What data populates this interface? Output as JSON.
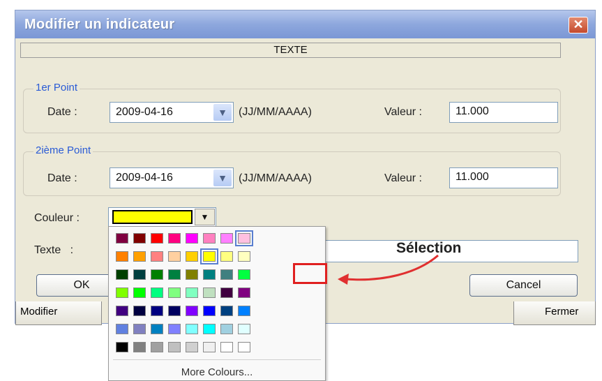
{
  "dialog": {
    "title": "Modifier un indicateur",
    "close_label": "✕",
    "type_header": "TEXTE"
  },
  "point1": {
    "legend": "1er Point",
    "date_label": "Date :",
    "date_value": "2009-04-16",
    "date_format": "(JJ/MM/AAAA)",
    "value_label": "Valeur :",
    "value": "11.000"
  },
  "point2": {
    "legend": "2ième Point",
    "date_label": "Date :",
    "date_value": "2009-04-16",
    "date_format": "(JJ/MM/AAAA)",
    "value_label": "Valeur :",
    "value": "11.000"
  },
  "color": {
    "label": "Couleur :",
    "selected": "#ffff00"
  },
  "text_label": "Texte   :",
  "buttons": {
    "ok": "OK",
    "cancel": "Cancel"
  },
  "background_buttons": {
    "modify": "Modifier",
    "close": "Fermer"
  },
  "palette": {
    "more_colours": "More Colours...",
    "rows": [
      [
        "#7f0040",
        "#800000",
        "#ff0000",
        "#ff0080",
        "#ff00ff",
        "#ff80c0",
        "#ff80ff",
        "#ffc0e0"
      ],
      [
        "#ff8000",
        "#ffa000",
        "#ff8080",
        "#ffd0a0",
        "#ffd000",
        "#ffff00",
        "#ffff80",
        "#ffffc0"
      ],
      [
        "#004000",
        "#004040",
        "#008000",
        "#008040",
        "#808000",
        "#008080",
        "#408080",
        "#00ff40"
      ],
      [
        "#80ff00",
        "#00ff00",
        "#00ff80",
        "#80ff80",
        "#80ffc0",
        "#c0e0c0",
        "#400040",
        "#800080"
      ],
      [
        "#400080",
        "#000040",
        "#000080",
        "#000060",
        "#8000ff",
        "#0000ff",
        "#004080",
        "#0080ff"
      ],
      [
        "#6080e0",
        "#8080c0",
        "#0080c0",
        "#8080ff",
        "#80ffff",
        "#00ffff",
        "#a0d0e0",
        "#e0ffff"
      ],
      [
        "#000000",
        "#808080",
        "#a0a0a0",
        "#c0c0c0",
        "#d0d0d0",
        "#f0f0f0",
        "#ffffff",
        "#ffffff"
      ]
    ]
  },
  "annotation": {
    "label": "Sélection"
  }
}
